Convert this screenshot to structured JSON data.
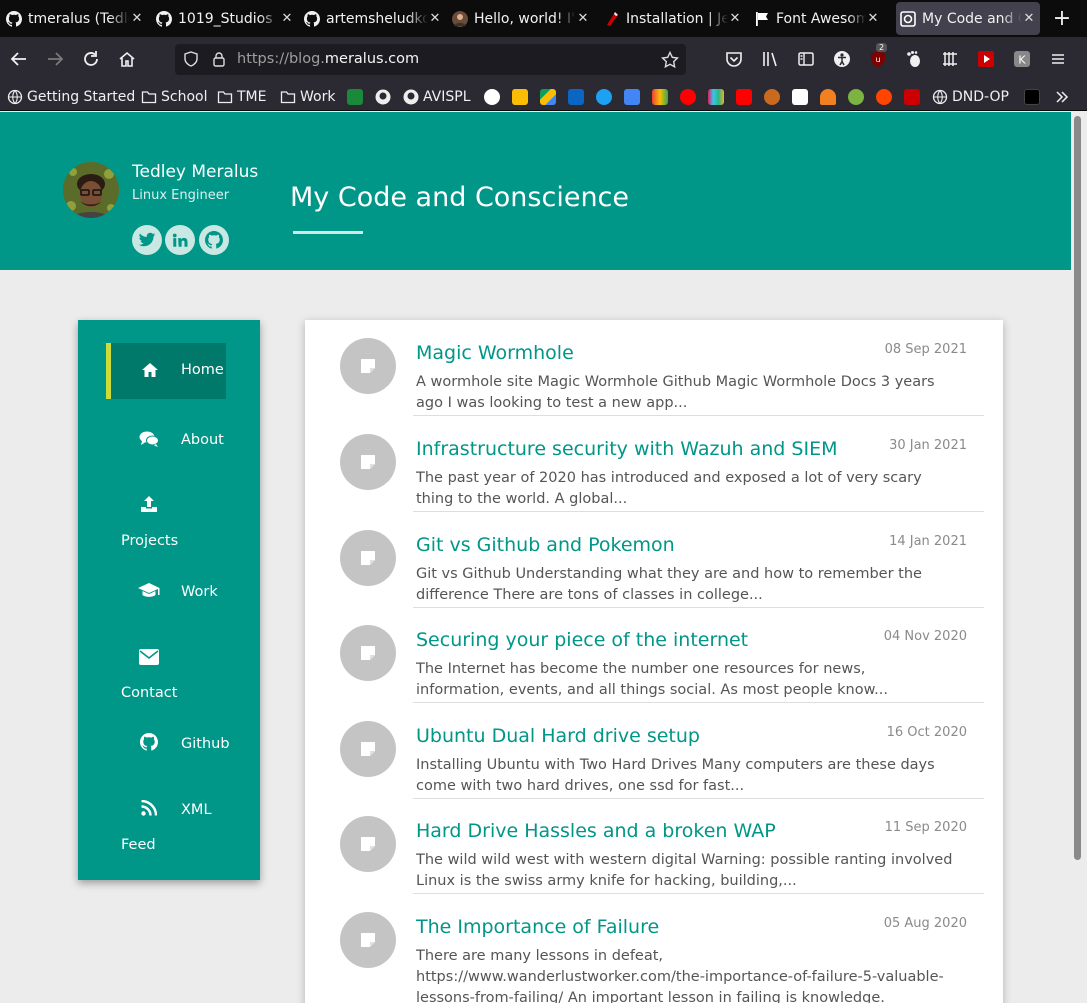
{
  "browser": {
    "tabs": [
      {
        "title": "tmeralus (Tedley",
        "icon": "github-icon"
      },
      {
        "title": "1019_Studios",
        "icon": "github-icon"
      },
      {
        "title": "artemsheludko",
        "icon": "github-icon"
      },
      {
        "title": "Hello, world! I'm",
        "icon": "avatar-icon"
      },
      {
        "title": "Installation | Jek",
        "icon": "jekyll-icon"
      },
      {
        "title": "Font Awesome",
        "icon": "flag-icon"
      },
      {
        "title": "My Code and Co",
        "icon": "site-icon"
      }
    ],
    "url_prefix": "https://blog.",
    "url_domain": "meralus.com",
    "notification_count": "2",
    "bookmarks": [
      "Getting Started",
      "School",
      "TME",
      "Work",
      "AVISPL",
      "DND-OP"
    ]
  },
  "header": {
    "author_name": "Tedley Meralus",
    "author_title": "Linux Engineer",
    "site_title": "My Code and Conscience"
  },
  "menu": {
    "items": [
      {
        "label": "Home"
      },
      {
        "label": "About"
      },
      {
        "label": "Projects"
      },
      {
        "label": "Work"
      },
      {
        "label": "Contact"
      },
      {
        "label": "Github"
      },
      {
        "label": "XML"
      },
      {
        "label": "Feed"
      }
    ]
  },
  "posts": [
    {
      "title": "Magic Wormhole",
      "date": "08 Sep 2021",
      "excerpt": "A wormhole site Magic Wormhole Github Magic Wormhole Docs 3 years ago I was looking to test a new app..."
    },
    {
      "title": "Infrastructure security with Wazuh and SIEM",
      "date": "30 Jan 2021",
      "excerpt": "The past year of 2020 has introduced and exposed a lot of very scary thing to the world. A global..."
    },
    {
      "title": "Git vs Github and Pokemon",
      "date": "14 Jan 2021",
      "excerpt": "Git vs Github Understanding what they are and how to remember the difference There are tons of classes in college..."
    },
    {
      "title": "Securing your piece of the internet",
      "date": "04 Nov 2020",
      "excerpt": "The Internet has become the number one resources for news, information, events, and all things social. As most people know..."
    },
    {
      "title": "Ubuntu Dual Hard drive setup",
      "date": "16 Oct 2020",
      "excerpt": "Installing Ubuntu with Two Hard Drives Many computers are these days come with two hard drives, one ssd for fast..."
    },
    {
      "title": "Hard Drive Hassles and a broken WAP",
      "date": "11 Sep 2020",
      "excerpt": "The wild wild west with western digital Warning: possible ranting involved Linux is the swiss army knife for hacking, building,..."
    },
    {
      "title": "The Importance of Failure",
      "date": "05 Aug 2020",
      "excerpt": "There are many lessons in defeat, https://www.wanderlustworker.com/the-importance-of-failure-5-valuable-lessons-from-failing/ An important lesson in failing is knowledge. Knowledge of self, knowledge of the..."
    }
  ],
  "colors": {
    "accent": "#009688",
    "accent_dark": "#00796b",
    "active_bar": "#cddc39"
  }
}
